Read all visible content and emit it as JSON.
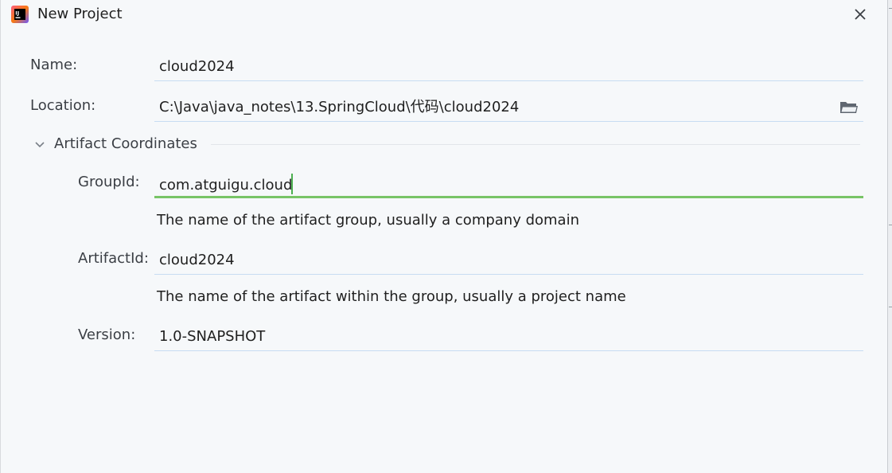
{
  "window": {
    "title": "New Project",
    "app_icon": "intellij-idea-icon",
    "close_icon": "close-icon"
  },
  "form": {
    "name": {
      "label": "Name:",
      "value": "cloud2024"
    },
    "location": {
      "label": "Location:",
      "value": "C:\\Java\\java_notes\\13.SpringCloud\\代码\\cloud2024",
      "browse_icon": "folder-icon"
    },
    "artifact_section": {
      "title": "Artifact Coordinates",
      "expanded": true,
      "toggle_icon": "chevron-down-icon",
      "group_id": {
        "label": "GroupId:",
        "value": "com.atguigu.cloud",
        "hint": "The name of the artifact group, usually a company domain"
      },
      "artifact_id": {
        "label": "ArtifactId:",
        "value": "cloud2024",
        "hint": "The name of the artifact within the group, usually a project name"
      },
      "version": {
        "label": "Version:",
        "value": "1.0-SNAPSHOT"
      }
    }
  },
  "colors": {
    "focus_underline": "#78c466",
    "field_underline": "#c7dcf2",
    "background": "#f6f8fa"
  }
}
